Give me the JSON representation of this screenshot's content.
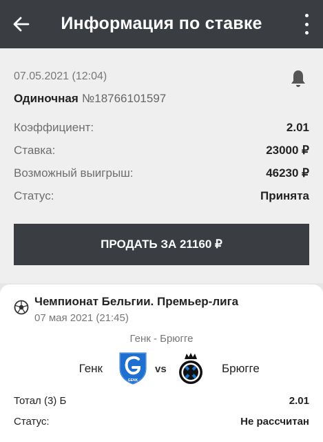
{
  "header": {
    "title": "Информация по ставке"
  },
  "bet": {
    "date": "07.05.2021 (12:04)",
    "type": "Одиночная",
    "number": "№18766101597",
    "coef_label": "Коэффициент:",
    "coef_value": "2.01",
    "stake_label": "Ставка:",
    "stake_value": "23000 ₽",
    "win_label": "Возможный выигрыш:",
    "win_value": "46230 ₽",
    "status_label": "Статус:",
    "status_value": "Принята",
    "sell_label": "ПРОДАТЬ ЗА 21160 ₽"
  },
  "event": {
    "league": "Чемпионат Бельгии. Премьер-лига",
    "date": "07 мая 2021 (21:45)",
    "match": "Генк - Брюгге",
    "team1": "Генк",
    "vs": "vs",
    "team2": "Брюгге",
    "team1_logo_text": "GENK",
    "outcome_label": "Тотал (3) Б",
    "outcome_value": "2.01",
    "status_label": "Статус:",
    "status_value": "Не рассчитан"
  },
  "icons": {
    "back": "arrow-left-icon",
    "more": "more-vertical-icon",
    "bell": "bell-icon",
    "league": "soccer-ball-icon"
  },
  "colors": {
    "header_bg": "#3a3e42",
    "button_bg": "#3a3e42",
    "genk_blue": "#1f6fd1",
    "page_bg": "#efefef"
  }
}
